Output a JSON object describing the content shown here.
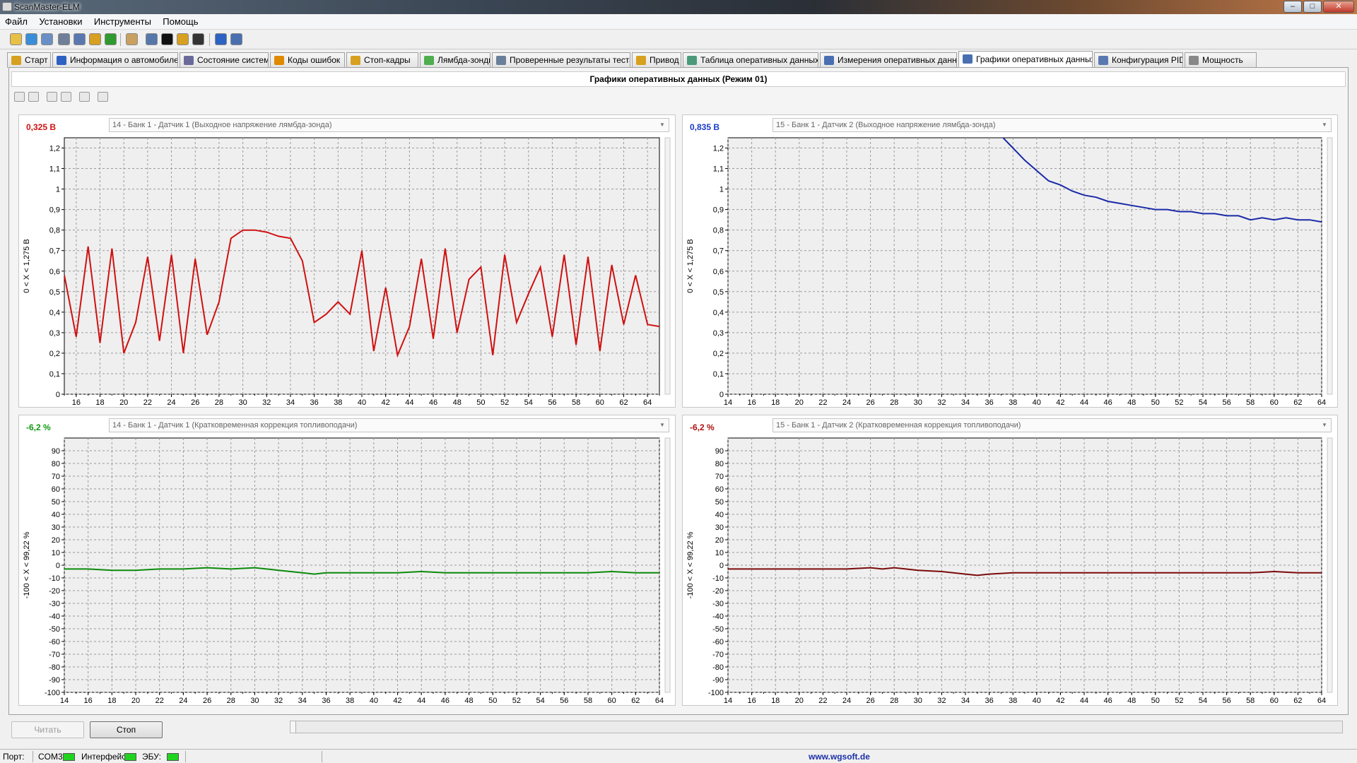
{
  "window": {
    "title": "ScanMaster-ELM",
    "buttons": [
      "–",
      "□",
      "✕"
    ]
  },
  "menu": [
    {
      "label": "Файл"
    },
    {
      "label": "Установки"
    },
    {
      "label": "Инструменты"
    },
    {
      "label": "Помощь"
    }
  ],
  "toolbar": [
    {
      "name": "connect-icon",
      "color": "#e8c045"
    },
    {
      "name": "globe-icon",
      "color": "#3a8ed8"
    },
    {
      "name": "document-icon",
      "color": "#6a8fc4"
    },
    {
      "name": "table-icon",
      "color": "#6f7f9a"
    },
    {
      "name": "grid-icon",
      "color": "#5a78b0"
    },
    {
      "name": "chart-icon",
      "color": "#d8a020"
    },
    {
      "name": "lamp-icon",
      "color": "#2f9a2f"
    },
    {
      "name": "clipboard-icon",
      "color": "#caa060"
    },
    {
      "name": "monitor-icon",
      "color": "#5577aa"
    },
    {
      "name": "terminal-icon",
      "color": "#111111"
    },
    {
      "name": "battery-icon",
      "color": "#d8a020"
    },
    {
      "name": "disc-icon",
      "color": "#333333"
    },
    {
      "name": "info-icon",
      "color": "#2d62c2"
    },
    {
      "name": "book-icon",
      "color": "#4a6fb0"
    }
  ],
  "tabs": [
    {
      "label": "Старт",
      "icon": "start-icon",
      "color": "#d8a020",
      "active": false
    },
    {
      "label": "Информация о автомобиле",
      "icon": "info-icon",
      "color": "#2d62c2",
      "active": false
    },
    {
      "label": "Состояние системы",
      "icon": "system-icon",
      "color": "#6a6a9a",
      "active": false
    },
    {
      "label": "Коды ошибок",
      "icon": "warning-icon",
      "color": "#e08a00",
      "active": false
    },
    {
      "label": "Стоп-кадры",
      "icon": "camera-icon",
      "color": "#d8a020",
      "active": false
    },
    {
      "label": "Лямбда-зонды",
      "icon": "lambda-icon",
      "color": "#4fae4f",
      "active": false
    },
    {
      "label": "Проверенные результаты теста",
      "icon": "gear-icon",
      "color": "#6a7f9a",
      "active": false
    },
    {
      "label": "Привод",
      "icon": "drive-icon",
      "color": "#d8a020",
      "active": false
    },
    {
      "label": "Таблица оперативных данных",
      "icon": "table-icon",
      "color": "#4a9a7a",
      "active": false
    },
    {
      "label": "Измерения оперативных данных",
      "icon": "grid-icon",
      "color": "#4a6fb0",
      "active": false
    },
    {
      "label": "Графики оперативных данных",
      "icon": "chart-icon",
      "color": "#4a6fb0",
      "active": true
    },
    {
      "label": "Конфигурация PID",
      "icon": "config-icon",
      "color": "#5a78b0",
      "active": false
    },
    {
      "label": "Мощность",
      "icon": "power-icon",
      "color": "#888888",
      "active": false
    }
  ],
  "panel": {
    "title": "Графики оперативных данных (Режим 01)"
  },
  "chart_data": [
    {
      "type": "line",
      "current_value": "0,325 В",
      "value_color": "#d01010",
      "sensor": "14 - Банк 1 - Датчик 1 (Выходное напряжение лямбда-зонда)",
      "ylabel": "0  < X <  1,275 В",
      "line_color": "#d01010",
      "xlim": [
        15,
        65
      ],
      "ylim": [
        0,
        1.25
      ],
      "xticks": [
        "16",
        "18",
        "20",
        "22",
        "24",
        "26",
        "28",
        "30",
        "32",
        "34",
        "36",
        "38",
        "40",
        "42",
        "44",
        "46",
        "48",
        "50",
        "52",
        "54",
        "56",
        "58",
        "60",
        "62",
        "64"
      ],
      "yticks": [
        "0",
        "0,1",
        "0,2",
        "0,3",
        "0,4",
        "0,5",
        "0,6",
        "0,7",
        "0,8",
        "0,9",
        "1",
        "1,1",
        "1,2"
      ],
      "x": [
        15,
        16,
        17,
        18,
        19,
        20,
        21,
        22,
        23,
        24,
        25,
        26,
        27,
        28,
        29,
        30,
        31,
        32,
        33,
        34,
        35,
        36,
        37,
        38,
        39,
        40,
        41,
        42,
        43,
        44,
        45,
        46,
        47,
        48,
        49,
        50,
        51,
        52,
        53,
        54,
        55,
        56,
        57,
        58,
        59,
        60,
        61,
        62,
        63,
        64,
        65
      ],
      "y": [
        0.58,
        0.28,
        0.72,
        0.25,
        0.71,
        0.2,
        0.35,
        0.67,
        0.26,
        0.68,
        0.2,
        0.66,
        0.29,
        0.45,
        0.76,
        0.8,
        0.8,
        0.79,
        0.77,
        0.76,
        0.65,
        0.35,
        0.39,
        0.45,
        0.39,
        0.7,
        0.21,
        0.52,
        0.19,
        0.33,
        0.66,
        0.27,
        0.71,
        0.3,
        0.56,
        0.62,
        0.19,
        0.68,
        0.35,
        0.49,
        0.62,
        0.28,
        0.68,
        0.24,
        0.67,
        0.21,
        0.63,
        0.34,
        0.58,
        0.34,
        0.33
      ]
    },
    {
      "type": "line",
      "current_value": "0,835 В",
      "value_color": "#1a3ac8",
      "sensor": "15 - Банк 1 - Датчик 2 (Выходное напряжение лямбда-зонда)",
      "ylabel": "0  < X <  1,275 В",
      "line_color": "#1a2aa8",
      "xlim": [
        14,
        64
      ],
      "ylim": [
        0,
        1.25
      ],
      "xticks": [
        "14",
        "16",
        "18",
        "20",
        "22",
        "24",
        "26",
        "28",
        "30",
        "32",
        "34",
        "36",
        "38",
        "40",
        "42",
        "44",
        "46",
        "48",
        "50",
        "52",
        "54",
        "56",
        "58",
        "60",
        "62",
        "64"
      ],
      "yticks": [
        "0",
        "0,1",
        "0,2",
        "0,3",
        "0,4",
        "0,5",
        "0,6",
        "0,7",
        "0,8",
        "0,9",
        "1",
        "1,1",
        "1,2"
      ],
      "x": [
        36,
        37,
        38,
        39,
        40,
        41,
        42,
        43,
        44,
        45,
        46,
        47,
        48,
        49,
        50,
        51,
        52,
        53,
        54,
        55,
        56,
        57,
        58,
        59,
        60,
        61,
        62,
        63,
        64
      ],
      "y": [
        1.27,
        1.26,
        1.2,
        1.14,
        1.09,
        1.04,
        1.02,
        0.99,
        0.97,
        0.96,
        0.94,
        0.93,
        0.92,
        0.91,
        0.9,
        0.9,
        0.89,
        0.89,
        0.88,
        0.88,
        0.87,
        0.87,
        0.85,
        0.86,
        0.85,
        0.86,
        0.85,
        0.85,
        0.84
      ]
    },
    {
      "type": "line",
      "current_value": "-6,2 %",
      "value_color": "#129a12",
      "sensor": "14 - Банк 1 - Датчик 1 (Кратковременная коррекция топливоподачи)",
      "ylabel": "-100  < X <  99,22 %",
      "line_color": "#0a8a0a",
      "xlim": [
        14,
        64
      ],
      "ylim": [
        -100,
        100
      ],
      "xticks": [
        "14",
        "16",
        "18",
        "20",
        "22",
        "24",
        "26",
        "28",
        "30",
        "32",
        "34",
        "36",
        "38",
        "40",
        "42",
        "44",
        "46",
        "48",
        "50",
        "52",
        "54",
        "56",
        "58",
        "60",
        "62",
        "64"
      ],
      "yticks": [
        "-100",
        "-90",
        "-80",
        "-70",
        "-60",
        "-50",
        "-40",
        "-30",
        "-20",
        "-10",
        "0",
        "10",
        "20",
        "30",
        "40",
        "50",
        "60",
        "70",
        "80",
        "90"
      ],
      "x": [
        14,
        16,
        18,
        20,
        22,
        24,
        26,
        28,
        30,
        32,
        34,
        35,
        36,
        38,
        40,
        42,
        44,
        46,
        48,
        50,
        52,
        54,
        56,
        58,
        60,
        62,
        64
      ],
      "y": [
        -3,
        -3,
        -4,
        -4,
        -3,
        -3,
        -2,
        -3,
        -2,
        -4,
        -6,
        -7,
        -6,
        -6,
        -6,
        -6,
        -5,
        -6,
        -6,
        -6,
        -6,
        -6,
        -6,
        -6,
        -5,
        -6,
        -6
      ]
    },
    {
      "type": "line",
      "current_value": "-6,2 %",
      "value_color": "#b01010",
      "sensor": "15 - Банк 1 - Датчик 2 (Кратковременная коррекция топливоподачи)",
      "ylabel": "-100  < X <  99,22 %",
      "line_color": "#7a0a0a",
      "xlim": [
        14,
        64
      ],
      "ylim": [
        -100,
        100
      ],
      "xticks": [
        "14",
        "16",
        "18",
        "20",
        "22",
        "24",
        "26",
        "28",
        "30",
        "32",
        "34",
        "36",
        "38",
        "40",
        "42",
        "44",
        "46",
        "48",
        "50",
        "52",
        "54",
        "56",
        "58",
        "60",
        "62",
        "64"
      ],
      "yticks": [
        "-100",
        "-90",
        "-80",
        "-70",
        "-60",
        "-50",
        "-40",
        "-30",
        "-20",
        "-10",
        "0",
        "10",
        "20",
        "30",
        "40",
        "50",
        "60",
        "70",
        "80",
        "90"
      ],
      "x": [
        14,
        16,
        18,
        20,
        22,
        24,
        26,
        27,
        28,
        30,
        32,
        34,
        35,
        36,
        38,
        40,
        42,
        44,
        46,
        48,
        50,
        52,
        54,
        56,
        58,
        60,
        62,
        64
      ],
      "y": [
        -3,
        -3,
        -3,
        -3,
        -3,
        -3,
        -2,
        -3,
        -2,
        -4,
        -5,
        -7,
        -8,
        -7,
        -6,
        -6,
        -6,
        -6,
        -6,
        -6,
        -6,
        -6,
        -6,
        -6,
        -6,
        -5,
        -6,
        -6
      ]
    }
  ],
  "buttons": {
    "read": "Читать",
    "stop": "Стоп"
  },
  "status": {
    "port_label": "Порт:",
    "port": "COM3",
    "interface_label": "Интерфейс",
    "ecu_label": "ЭБУ:",
    "website": "www.wgsoft.de",
    "led_color": "#1fd31f"
  }
}
